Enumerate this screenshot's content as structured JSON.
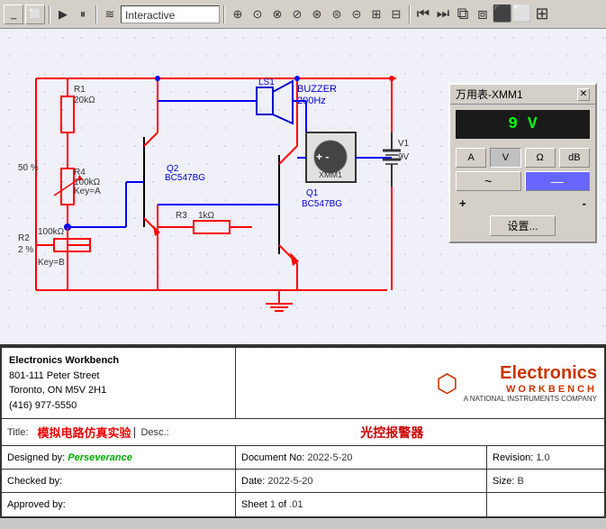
{
  "toolbar": {
    "mode_label": "Interactive",
    "play_icon": "▶",
    "pause_icon": "⏸",
    "wave_icon": "≋",
    "icons": [
      "⊕",
      "⊙",
      "⊗",
      "⊘",
      "⊛",
      "⊜",
      "⊝",
      "⊞",
      "⊟",
      "⊠",
      "⊡",
      "⊢",
      "⊣"
    ]
  },
  "multimeter": {
    "title": "万用表-XMM1",
    "close": "✕",
    "display_value": "9 V",
    "buttons": [
      "A",
      "V",
      "Ω",
      "dB"
    ],
    "active_button": "V",
    "wave_buttons": [
      "~",
      "—"
    ],
    "active_wave": "—",
    "plus_terminal": "+",
    "minus_terminal": "-",
    "settings_label": "设置..."
  },
  "circuit": {
    "components": [
      {
        "id": "R1",
        "label": "R1",
        "value": "20kΩ"
      },
      {
        "id": "R4",
        "label": "R4",
        "value": "100kΩ\nKey=A"
      },
      {
        "id": "R2",
        "label": "R2",
        "value": "100kΩ\nKey=B"
      },
      {
        "id": "R3",
        "label": "R3",
        "value": "1kΩ"
      },
      {
        "id": "Q2",
        "label": "Q2\nBC547BG"
      },
      {
        "id": "Q1",
        "label": "Q1\nBC547BG"
      },
      {
        "id": "LS1",
        "label": "LS1"
      },
      {
        "id": "BUZZER",
        "label": "BUZZER\n200Hz"
      },
      {
        "id": "XMM1",
        "label": "XMM1"
      },
      {
        "id": "V1",
        "label": "V1\n9V"
      },
      {
        "id": "pct50",
        "label": "50 %"
      },
      {
        "id": "pct2",
        "label": "2 %"
      }
    ]
  },
  "title_block": {
    "company_line1": "Electronics Workbench",
    "company_line2": "801-111 Peter Street",
    "company_line3": "Toronto, ON M5V 2H1",
    "company_line4": "(416) 977-5550",
    "logo_top": "Electronics",
    "logo_bottom": "WORKBENCH",
    "logo_sub": "A NATIONAL INSTRUMENTS COMPANY",
    "title_label": "Title:",
    "title_value": "模拟电路仿真实验",
    "desc_label": "Desc.:",
    "project_name": "光控报警器",
    "designed_by_label": "Designed by:",
    "designed_by_value": "Perseverance",
    "doc_no_label": "Document No:",
    "doc_no_value": "2022-5-20",
    "revision_label": "Revision:",
    "revision_value": "1.0",
    "checked_by_label": "Checked by:",
    "date_label": "Date:",
    "date_value": "2022-5-20",
    "size_label": "Size:",
    "size_value": "B",
    "approved_by_label": "Approved by:",
    "sheet_label": "Sheet",
    "sheet_value": "1",
    "of_label": "of",
    "of_value": ".01"
  }
}
